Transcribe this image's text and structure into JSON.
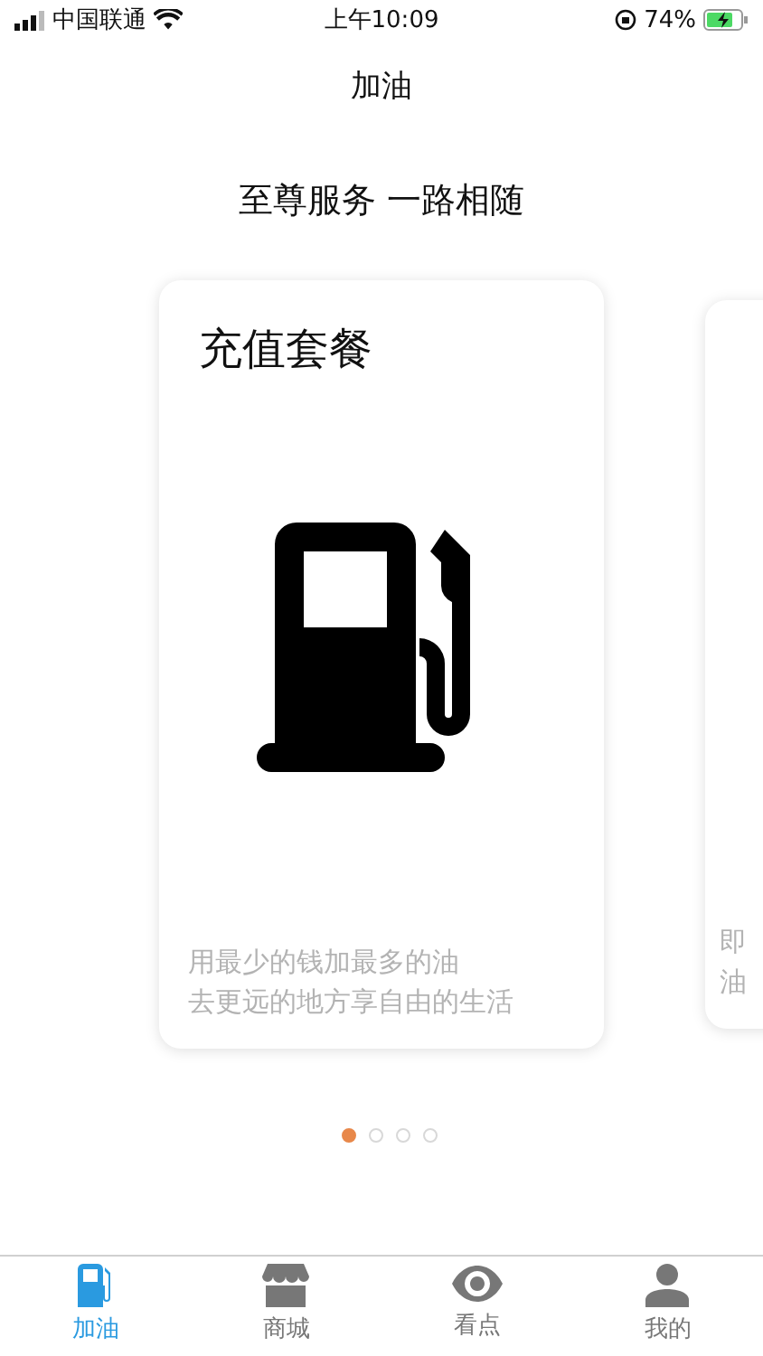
{
  "status_bar": {
    "carrier": "中国联通",
    "time": "上午10:09",
    "battery": "74%"
  },
  "nav": {
    "title": "加油"
  },
  "slogan": "至尊服务 一路相随",
  "cards": [
    {
      "title": "充值套餐",
      "kind": "pump",
      "lines": [
        "用最少的钱加最多的油",
        "去更远的地方享自由的生活"
      ]
    },
    {
      "kind": "partial",
      "lines": [
        "即",
        "油"
      ]
    }
  ],
  "dots": [
    {
      "selected": true
    },
    {
      "selected": false
    },
    {
      "selected": false
    },
    {
      "selected": false
    }
  ],
  "tabs": [
    {
      "label": "加油",
      "kind": "pump",
      "selected": true
    },
    {
      "label": "商城",
      "kind": "shop",
      "selected": false
    },
    {
      "label": "看点",
      "kind": "eye",
      "selected": false
    },
    {
      "label": "我的",
      "kind": "person",
      "selected": false
    }
  ]
}
